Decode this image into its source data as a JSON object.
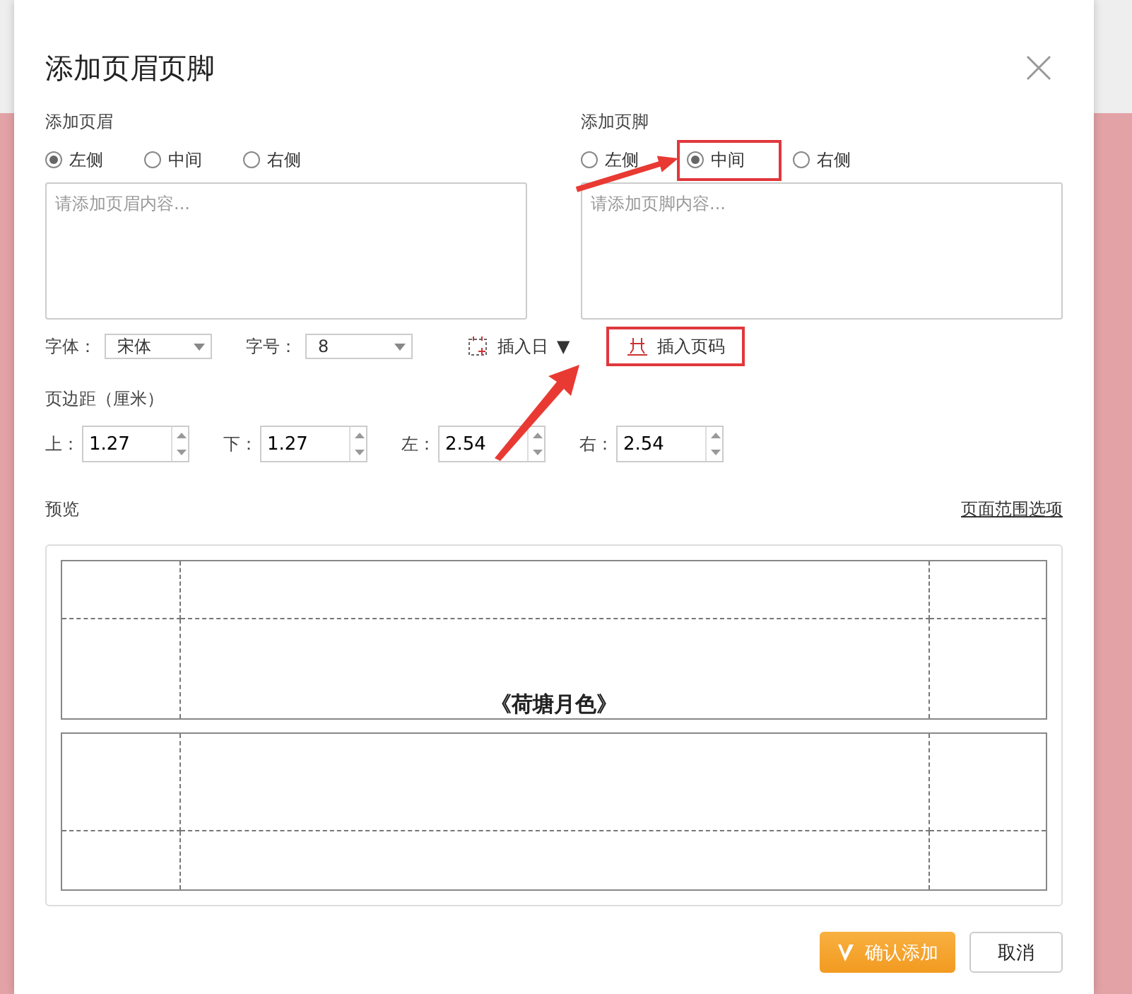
{
  "dialog": {
    "title": "添加页眉页脚"
  },
  "header": {
    "label": "添加页眉",
    "options": [
      {
        "label": "左侧",
        "selected": true,
        "highlighted": false
      },
      {
        "label": "中间",
        "selected": false,
        "highlighted": false
      },
      {
        "label": "右侧",
        "selected": false,
        "highlighted": false
      }
    ],
    "placeholder": "请添加页眉内容..."
  },
  "footer": {
    "label": "添加页脚",
    "options": [
      {
        "label": "左侧",
        "selected": false,
        "highlighted": false
      },
      {
        "label": "中间",
        "selected": true,
        "highlighted": true
      },
      {
        "label": "右侧",
        "selected": false,
        "highlighted": false
      }
    ],
    "placeholder": "请添加页脚内容..."
  },
  "font": {
    "label": "字体：",
    "value": "宋体"
  },
  "size": {
    "label": "字号：",
    "value": "8"
  },
  "insert_date": {
    "label": "插入日",
    "caret": "▼"
  },
  "insert_page_number": {
    "label": "插入页码",
    "highlighted": true
  },
  "margins": {
    "label": "页边距（厘米）",
    "fields": [
      {
        "label": "上：",
        "value": "1.27"
      },
      {
        "label": "下：",
        "value": "1.27"
      },
      {
        "label": "左：",
        "value": "2.54"
      },
      {
        "label": "右：",
        "value": "2.54"
      }
    ]
  },
  "preview": {
    "label": "预览",
    "link": "页面范围选项",
    "page_title": "《荷塘月色》"
  },
  "buttons": [
    {
      "label": "确认添加",
      "kind": "vip"
    },
    {
      "label": "取消",
      "kind": "plain"
    }
  ]
}
